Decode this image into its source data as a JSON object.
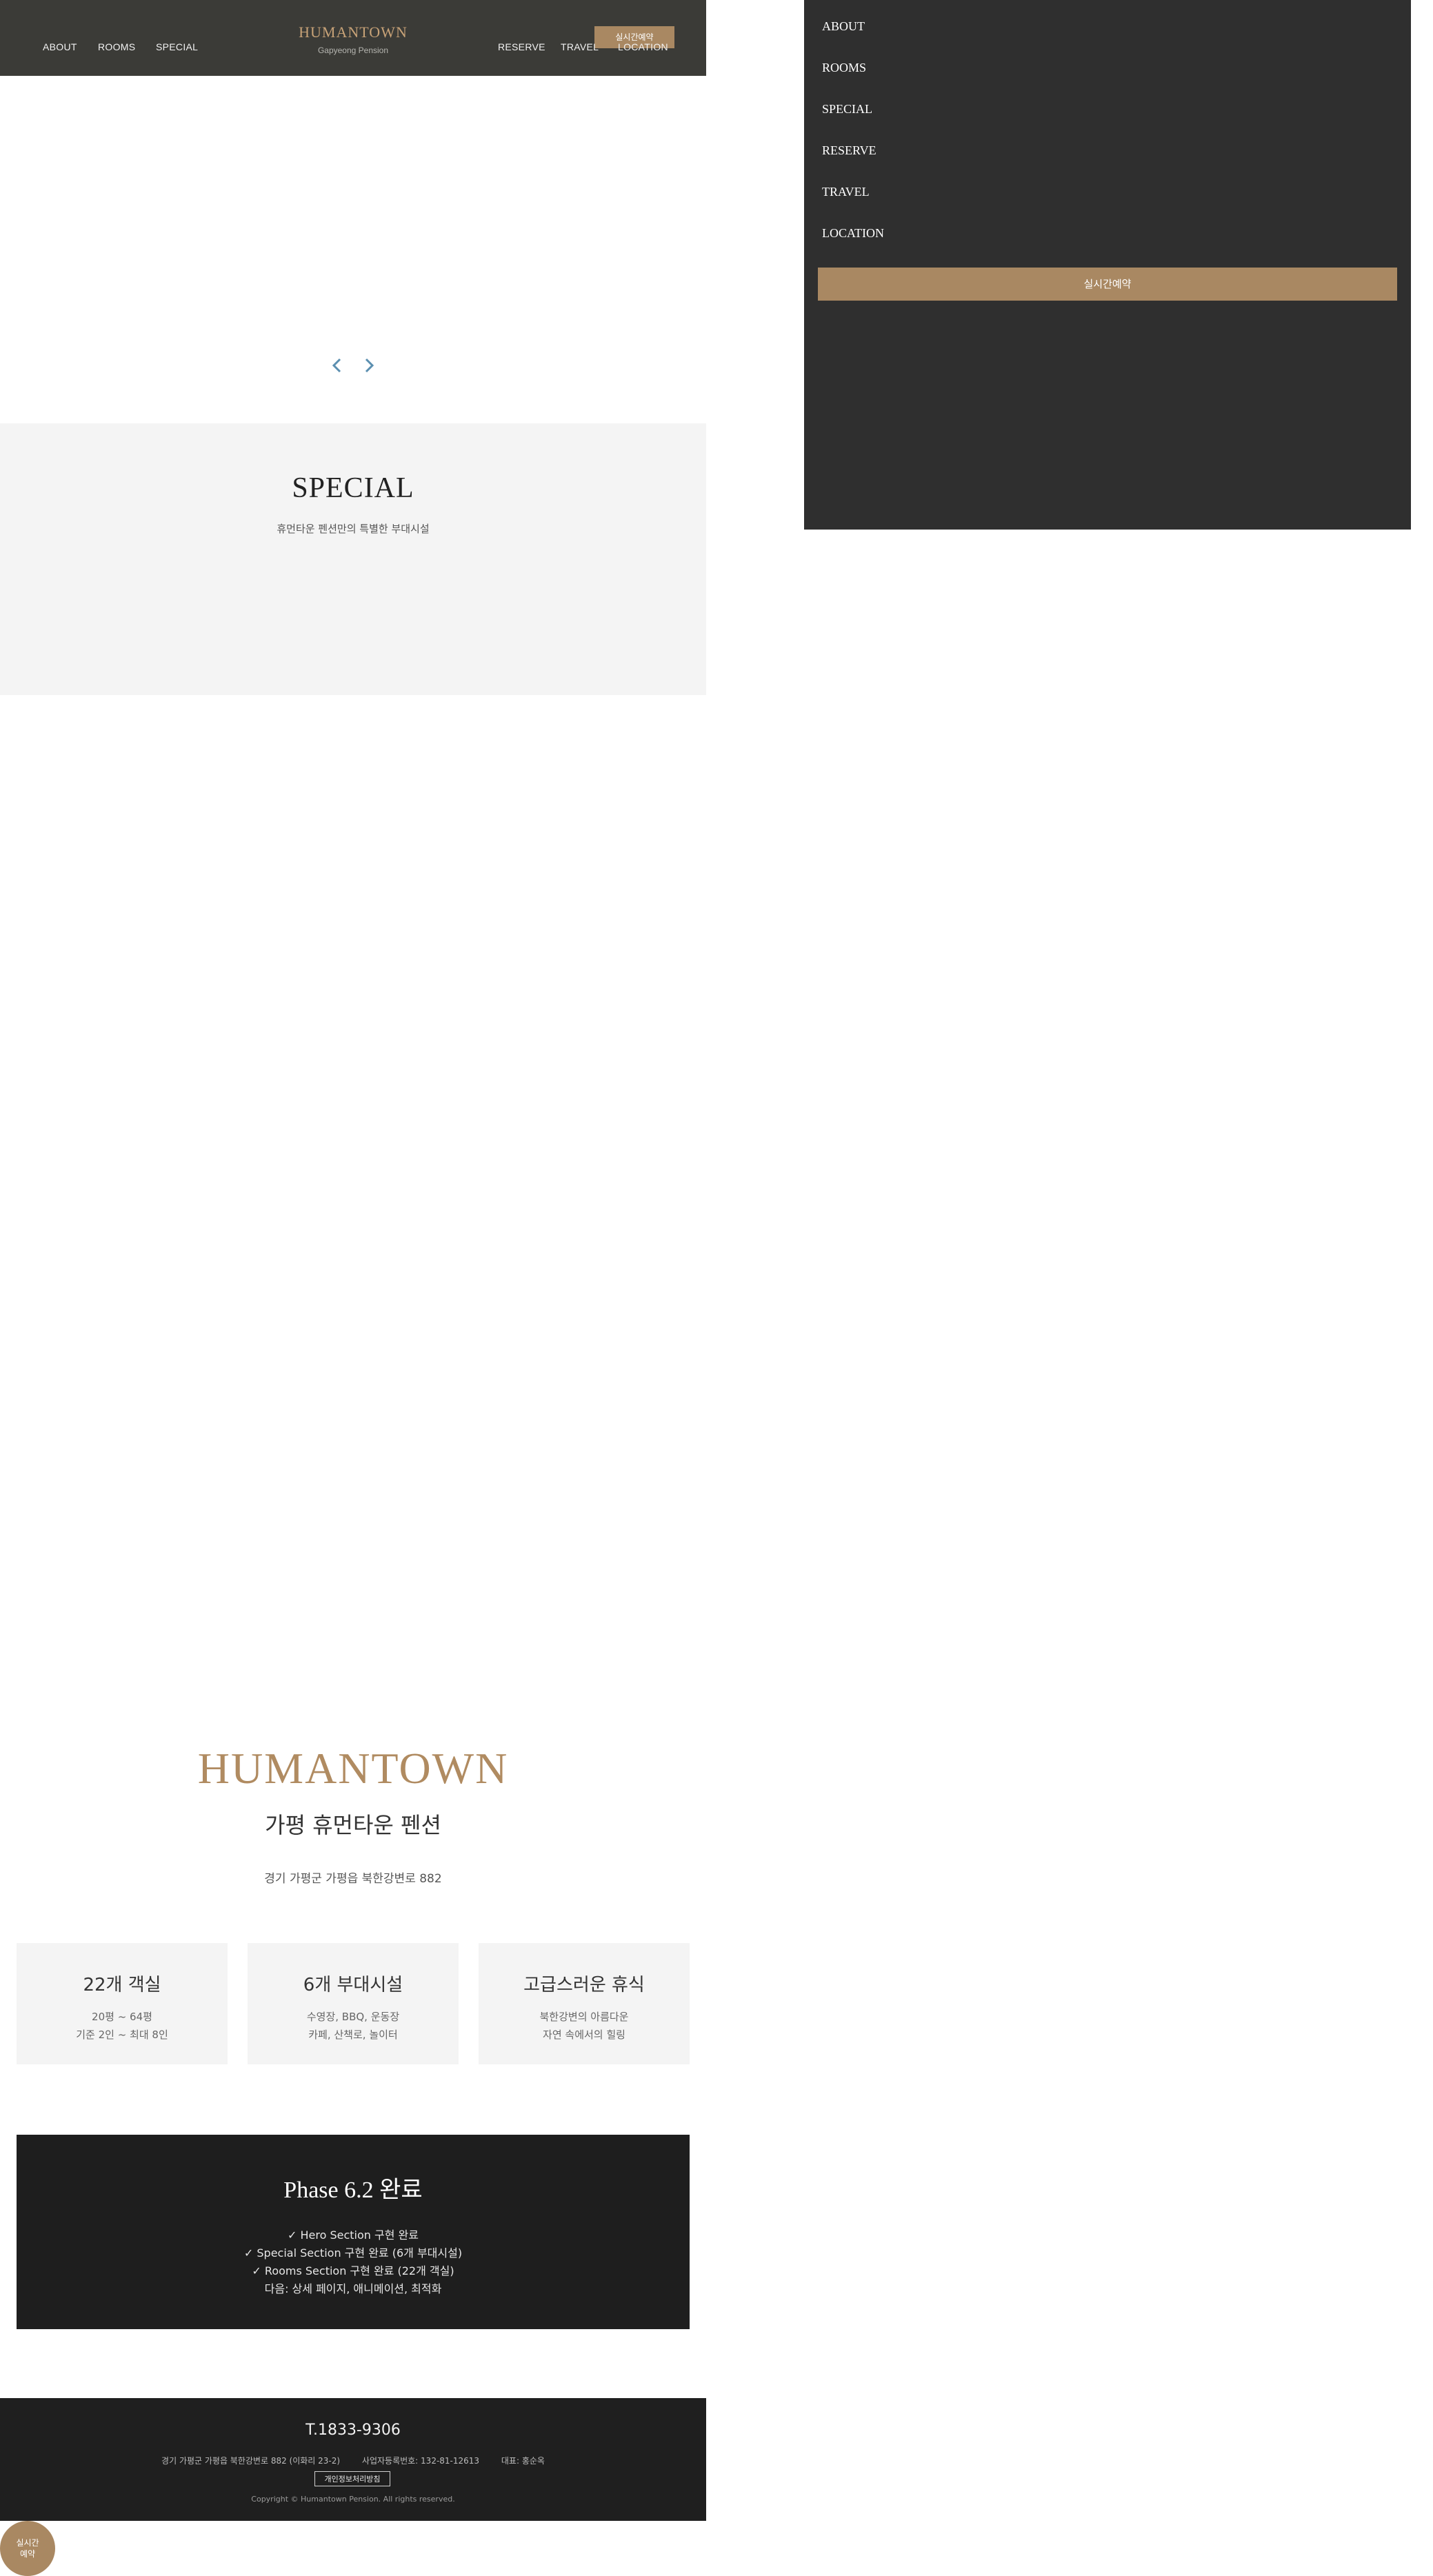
{
  "header": {
    "nav_left": [
      "ABOUT",
      "ROOMS",
      "SPECIAL"
    ],
    "nav_right": [
      "RESERVE",
      "TRAVEL",
      "LOCATION"
    ],
    "brand": "HUMANTOWN",
    "brand_sub": "Gapyeong Pension",
    "reserve_button": "실시간예약"
  },
  "hero": {
    "prev_icon": "chevron-left-icon",
    "next_icon": "chevron-right-icon"
  },
  "special": {
    "title": "SPECIAL",
    "subtitle": "휴먼타운 펜션만의 특별한 부대시설"
  },
  "side_menu": {
    "items": [
      "ABOUT",
      "ROOMS",
      "SPECIAL",
      "RESERVE",
      "TRAVEL",
      "LOCATION"
    ],
    "button": "실시간예약"
  },
  "intro": {
    "brand": "HUMANTOWN",
    "name": "가평 휴먼타운 펜션",
    "address": "경기 가평군 가평읍 북한강변로 882",
    "cards": [
      {
        "title": "22개 객실",
        "line1": "20평 ~ 64평",
        "line2": "기준 2인 ~ 최대 8인"
      },
      {
        "title": "6개 부대시설",
        "line1": "수영장, BBQ, 운동장",
        "line2": "카페, 산책로, 놀이터"
      },
      {
        "title": "고급스러운 휴식",
        "line1": "북한강변의 아름다운",
        "line2": "자연 속에서의 힐링"
      }
    ]
  },
  "phase": {
    "title": "Phase 6.2 완료",
    "lines": [
      "✓ Hero Section 구현 완료",
      "✓ Special Section 구현 완료 (6개 부대시설)",
      "✓ Rooms Section 구현 완료 (22개 객실)",
      "다음: 상세 페이지, 애니메이션, 최적화"
    ]
  },
  "footer": {
    "phone": "T.1833-9306",
    "address": "경기 가평군 가평읍 북한강변로 882 (이화리 23-2)",
    "business_no": "사업자등록번호: 132-81-12613",
    "ceo": "대표: 홍순옥",
    "privacy": "개인정보처리방침",
    "copyright": "Copyright © Humantown Pension. All rights reserved."
  },
  "floating": {
    "line1": "실시간",
    "line2": "예약"
  },
  "colors": {
    "header_bg": "#3b3b37",
    "accent_gold": "#a98862",
    "side_menu_bg": "#2f2f2f",
    "dark_box": "#1e1e1e"
  }
}
